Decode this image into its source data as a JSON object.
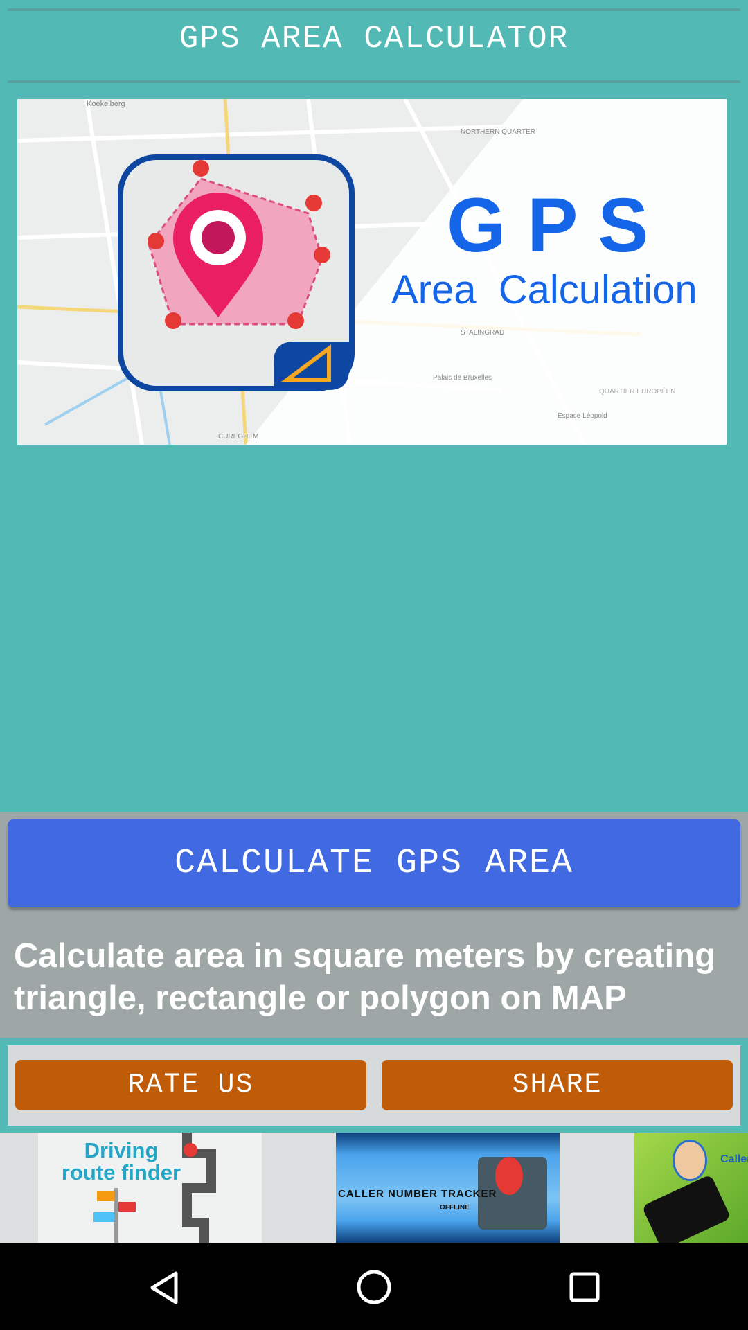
{
  "header": {
    "title": "GPS AREA CALCULATOR"
  },
  "banner": {
    "headline": "G P S",
    "subline": "Area  Calculation",
    "map_labels": [
      "Koekelberg",
      "NORTHERN QUARTER",
      "STALINGRAD",
      "CUREGHEM",
      "Palais de Bruxelles",
      "Espace Léopold",
      "QUARTIER EUROPÉEN"
    ]
  },
  "main": {
    "calculate_label": "CALCULATE GPS AREA",
    "description": "Calculate area in square meters by creating triangle, rectangle or polygon on MAP"
  },
  "actions": {
    "rate_label": "RATE US",
    "share_label": "SHARE"
  },
  "ads": [
    {
      "line1": "Driving",
      "line2": "route finder"
    },
    {
      "line1": "CALLER NUMBER TRACKER",
      "line2": "OFFLINE"
    },
    {
      "line1": "Caller"
    }
  ],
  "colors": {
    "background": "#52b9b5",
    "primary_button": "#4169e1",
    "action_button": "#c05c08",
    "panel": "#9ea6a6"
  },
  "navbar": {
    "icons": [
      "back-icon",
      "home-icon",
      "recents-icon"
    ]
  }
}
